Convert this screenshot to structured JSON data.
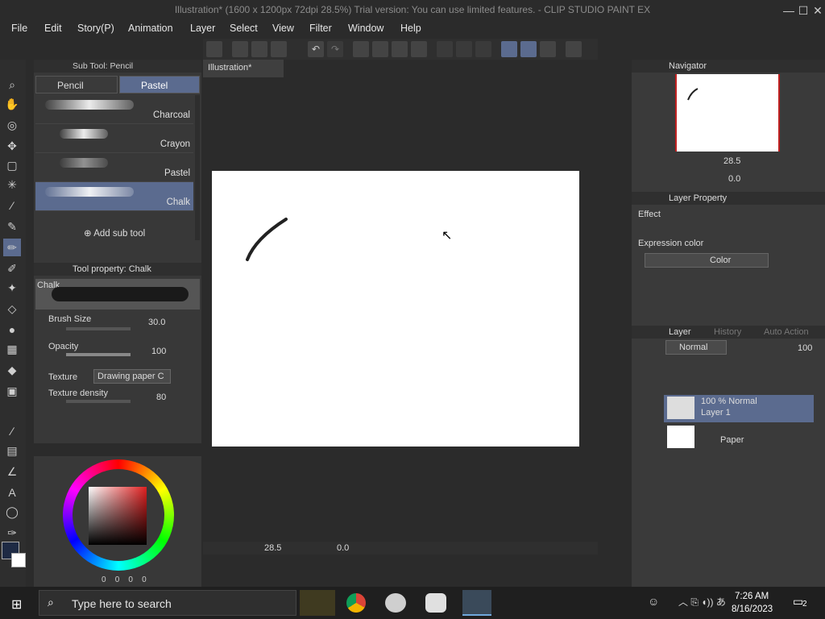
{
  "app": {
    "title": "Illustration* (1600 x 1200px 72dpi 28.5%)  Trial version: You can use limited features. - CLIP STUDIO PAINT EX"
  },
  "menu": [
    "File",
    "Edit",
    "Story(P)",
    "Animation",
    "Layer",
    "Select",
    "View",
    "Filter",
    "Window",
    "Help"
  ],
  "subtool": {
    "header": "Sub Tool: Pencil",
    "tabs": [
      "Pencil",
      "Pastel"
    ],
    "items": [
      "Charcoal",
      "Crayon",
      "Pastel",
      "Chalk"
    ],
    "add_label": "Add sub tool"
  },
  "toolprop": {
    "header": "Tool property: Chalk",
    "preview_name": "Chalk",
    "brush_size_label": "Brush Size",
    "brush_size_value": "30.0",
    "opacity_label": "Opacity",
    "opacity_value": "100",
    "texture_label": "Texture",
    "texture_value": "Drawing paper C",
    "texture_density_label": "Texture density",
    "texture_density_value": "80"
  },
  "color_wheel": {
    "values": [
      "0",
      "0",
      "0",
      "0"
    ]
  },
  "canvas": {
    "tab": "Illustration*",
    "zoom": "28.5",
    "rotation": "0.0"
  },
  "navigator": {
    "header": "Navigator",
    "zoom": "28.5",
    "rotation": "0.0"
  },
  "layer_property": {
    "header": "Layer Property",
    "effect_label": "Effect",
    "expression_label": "Expression color",
    "expression_value": "Color"
  },
  "layer_panel": {
    "tabs": [
      "Layer",
      "History",
      "Auto Action"
    ],
    "blend_mode": "Normal",
    "opacity": "100",
    "layers": [
      {
        "line1": "100 % Normal",
        "line2": "Layer 1"
      },
      {
        "line1": "",
        "line2": "Paper"
      }
    ]
  },
  "taskbar": {
    "search_placeholder": "Type here to search",
    "time": "7:26 AM",
    "date": "8/16/2023",
    "notifications": "2"
  },
  "colors": {
    "selection": "#5b6b8f",
    "panel": "#383838",
    "background": "#2b2b2b"
  }
}
